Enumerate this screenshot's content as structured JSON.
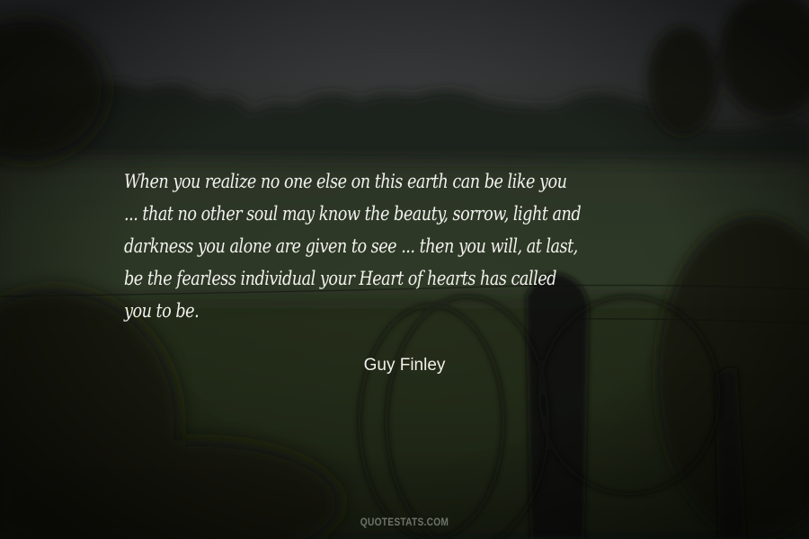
{
  "quote": {
    "lines": [
      "When you realize no one else on this earth can be like you",
      "... that no other soul may know the beauty, sorrow, light and",
      "darkness you alone are given to see ... then you will, at last,",
      "be the fearless individual your Heart of hearts has called",
      "you to be."
    ]
  },
  "author": "Guy Finley",
  "watermark": "QUOTESTATS.COM"
}
